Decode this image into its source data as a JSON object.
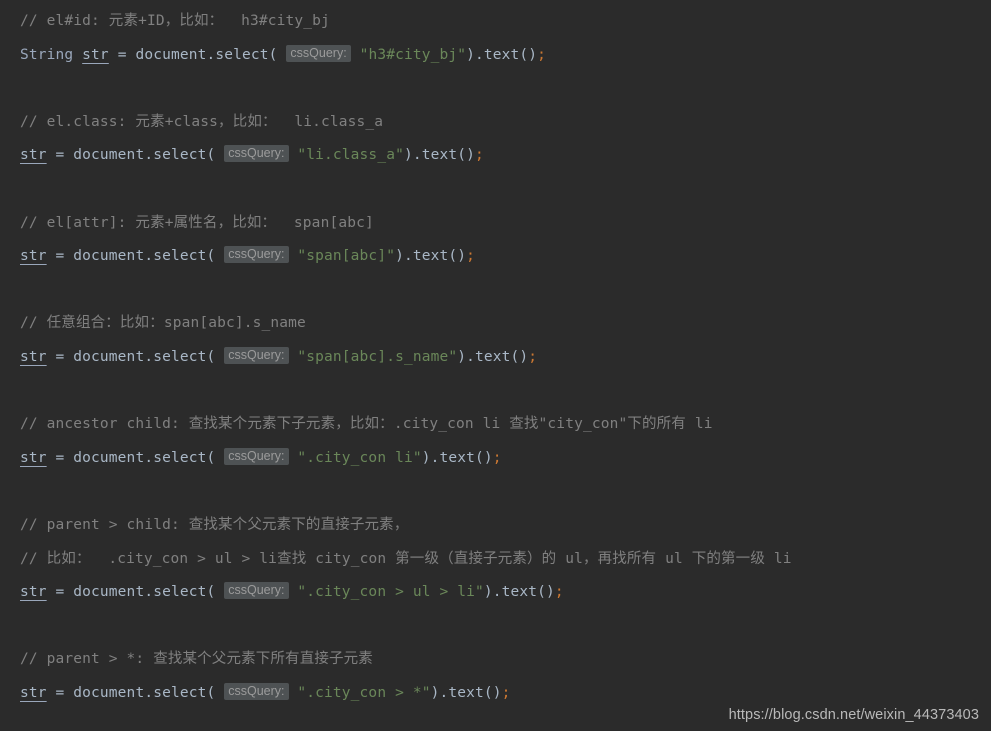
{
  "editor": {
    "theme_name": "darcula",
    "background_color": "#2b2b2b",
    "colors": {
      "comment": "#808080",
      "default_text": "#a9b7c6",
      "string_literal": "#6a8759",
      "semicolon": "#cc7832",
      "type_name": "#9aa7bb",
      "hint_chip_background": "#4e5254",
      "hint_chip_text": "#9b9b9b",
      "watermark": "#b9b9b9"
    },
    "language": "java",
    "parameter_hint_label": "cssQuery:",
    "lines": [
      {
        "kind": "comment",
        "text": "// el#id: 元素+ID，比如：  h3#city_bj"
      },
      {
        "kind": "code",
        "type_keyword": "String ",
        "variable": "str",
        "before_hint": " = document.select( ",
        "hint": "cssQuery:",
        "string_literal": " \"h3#city_bj\"",
        "after_string": ").text()",
        "terminator": ";"
      },
      {
        "kind": "blank"
      },
      {
        "kind": "comment",
        "text": "// el.class: 元素+class，比如：  li.class_a"
      },
      {
        "kind": "code",
        "type_keyword": "",
        "variable": "str",
        "before_hint": " = document.select( ",
        "hint": "cssQuery:",
        "string_literal": " \"li.class_a\"",
        "after_string": ").text()",
        "terminator": ";"
      },
      {
        "kind": "blank"
      },
      {
        "kind": "comment",
        "text": "// el[attr]: 元素+属性名，比如：  span[abc]"
      },
      {
        "kind": "code",
        "type_keyword": "",
        "variable": "str",
        "before_hint": " = document.select( ",
        "hint": "cssQuery:",
        "string_literal": " \"span[abc]\"",
        "after_string": ").text()",
        "terminator": ";"
      },
      {
        "kind": "blank"
      },
      {
        "kind": "comment",
        "text": "// 任意组合：比如：span[abc].s_name"
      },
      {
        "kind": "code",
        "type_keyword": "",
        "variable": "str",
        "before_hint": " = document.select( ",
        "hint": "cssQuery:",
        "string_literal": " \"span[abc].s_name\"",
        "after_string": ").text()",
        "terminator": ";"
      },
      {
        "kind": "blank"
      },
      {
        "kind": "comment",
        "text": "// ancestor child: 查找某个元素下子元素，比如：.city_con li 查找\"city_con\"下的所有 li"
      },
      {
        "kind": "code",
        "type_keyword": "",
        "variable": "str",
        "before_hint": " = document.select( ",
        "hint": "cssQuery:",
        "string_literal": " \".city_con li\"",
        "after_string": ").text()",
        "terminator": ";"
      },
      {
        "kind": "blank"
      },
      {
        "kind": "comment",
        "text": "// parent > child: 查找某个父元素下的直接子元素，"
      },
      {
        "kind": "comment",
        "text": "// 比如：  .city_con > ul > li查找 city_con 第一级（直接子元素）的 ul，再找所有 ul 下的第一级 li"
      },
      {
        "kind": "code",
        "type_keyword": "",
        "variable": "str",
        "before_hint": " = document.select( ",
        "hint": "cssQuery:",
        "string_literal": " \".city_con > ul > li\"",
        "after_string": ").text()",
        "terminator": ";"
      },
      {
        "kind": "blank"
      },
      {
        "kind": "comment",
        "text": "// parent > *: 查找某个父元素下所有直接子元素"
      },
      {
        "kind": "code",
        "type_keyword": "",
        "variable": "str",
        "before_hint": " = document.select( ",
        "hint": "cssQuery:",
        "string_literal": " \".city_con > *\"",
        "after_string": ").text()",
        "terminator": ";"
      }
    ],
    "watermark": "https://blog.csdn.net/weixin_44373403"
  }
}
